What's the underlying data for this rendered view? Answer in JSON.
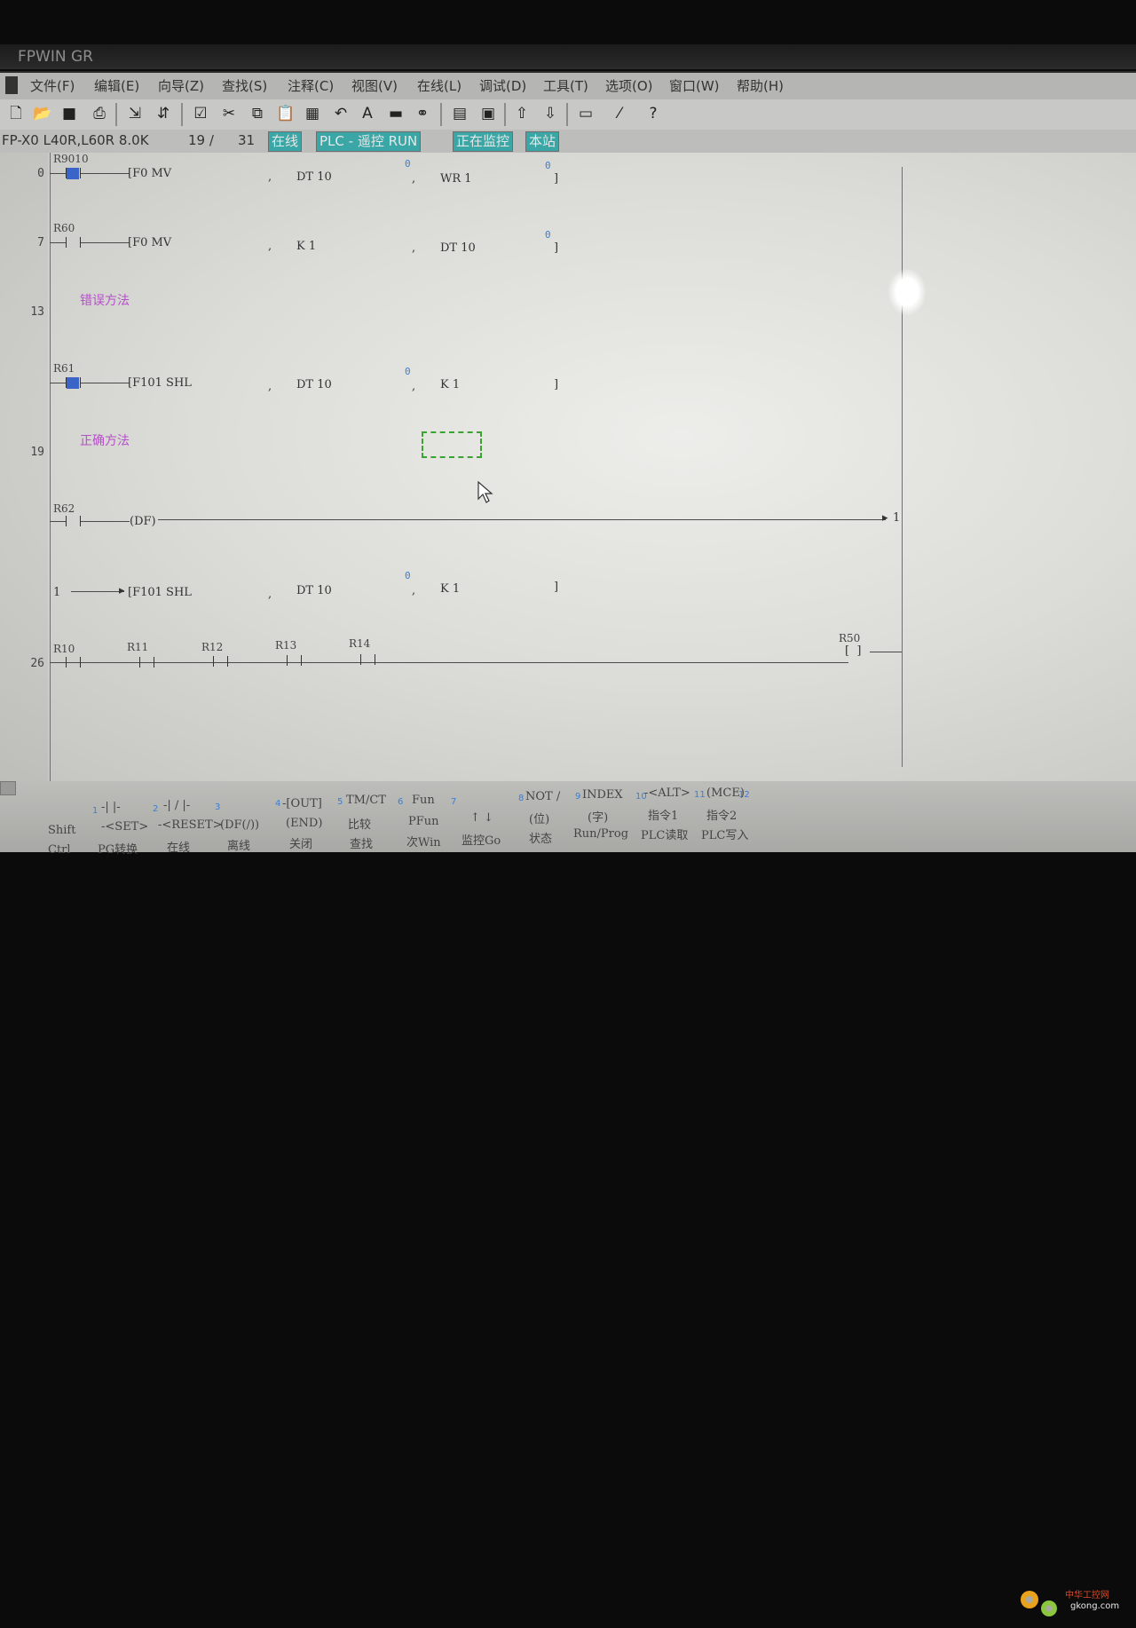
{
  "window": {
    "title": "FPWIN GR"
  },
  "menu": [
    "文件(F)",
    "编辑(E)",
    "向导(Z)",
    "查找(S)",
    "注释(C)",
    "视图(V)",
    "在线(L)",
    "调试(D)",
    "工具(T)",
    "选项(O)",
    "窗口(W)",
    "帮助(H)"
  ],
  "toolbar_icons": [
    "new-file-icon",
    "open-folder-icon",
    "save-icon",
    "print-icon",
    "convert-icon",
    "convert-all-icon",
    "check-icon",
    "cut-icon",
    "copy-icon",
    "paste-icon",
    "grid-icon",
    "undo-icon",
    "font-icon",
    "block-icon",
    "binoculars-icon",
    "monitor-icon",
    "pc-icon",
    "plc-upload-icon",
    "plc-download-icon",
    "run-icon",
    "online-edit-icon",
    "help-icon"
  ],
  "status": {
    "plc_model": "FP-X0 L40R,L60R 8.0K",
    "step_current": "19 /",
    "step_total": "31",
    "online": "在线",
    "plc_mode": "PLC - 遥控 RUN",
    "monitoring": "正在监控",
    "station": "本站"
  },
  "ladder": {
    "lines": [
      "0",
      "7",
      "13",
      "19",
      "26"
    ],
    "rung0": {
      "contact": "R9010",
      "instr": "[F0 MV",
      "op1": "DT 10",
      "op2": "WR 1",
      "idx1": "0",
      "idx2": "0",
      "close": "]"
    },
    "rung7": {
      "contact": "R60",
      "instr": "[F0 MV",
      "op1": "K 1",
      "op2": "DT 10",
      "idx2": "0",
      "close": "]"
    },
    "comment_wrong": "错误方法",
    "rung_r61": {
      "contact": "R61",
      "instr": "[F101 SHL",
      "op1": "DT 10",
      "op2": "K 1",
      "idx1": "0",
      "close": "]"
    },
    "comment_right": "正确方法",
    "rung_r62": {
      "contact": "R62",
      "df": "(DF)",
      "jump": "1"
    },
    "rung_shl2": {
      "marker": "1",
      "instr": "[F101 SHL",
      "op1": "DT 10",
      "op2": "K 1",
      "idx1": "0",
      "close": "]"
    },
    "rung26": {
      "contacts": [
        "R10",
        "R11",
        "R12",
        "R13",
        "R14"
      ],
      "coil": "R50"
    }
  },
  "fkeys": {
    "row1": [
      "-| |-",
      "-| / |-",
      "-[OUT]",
      "TM/CT",
      "Fun",
      "NOT /",
      "INDEX",
      "-<ALT>",
      "(MCE)"
    ],
    "row2": [
      "-<SET>",
      "-<RESET>",
      "(DF(/))",
      "(END)",
      "比较",
      "PFun",
      "↑ ↓",
      "(位)",
      "(字)",
      "指令1",
      "指令2"
    ],
    "row3": [
      "PG转换",
      "在线",
      "离线",
      "关闭",
      "查找",
      "次Win",
      "监控Go",
      "状态",
      "Run/Prog",
      "PLC读取",
      "PLC写入"
    ],
    "mods": [
      "Shift",
      "Ctrl"
    ],
    "nums": [
      "1",
      "2",
      "3",
      "4",
      "5",
      "6",
      "7",
      "8",
      "9",
      "10",
      "11",
      "12"
    ]
  },
  "watermark": {
    "name": "中华工控网",
    "url": "gkong.com"
  }
}
